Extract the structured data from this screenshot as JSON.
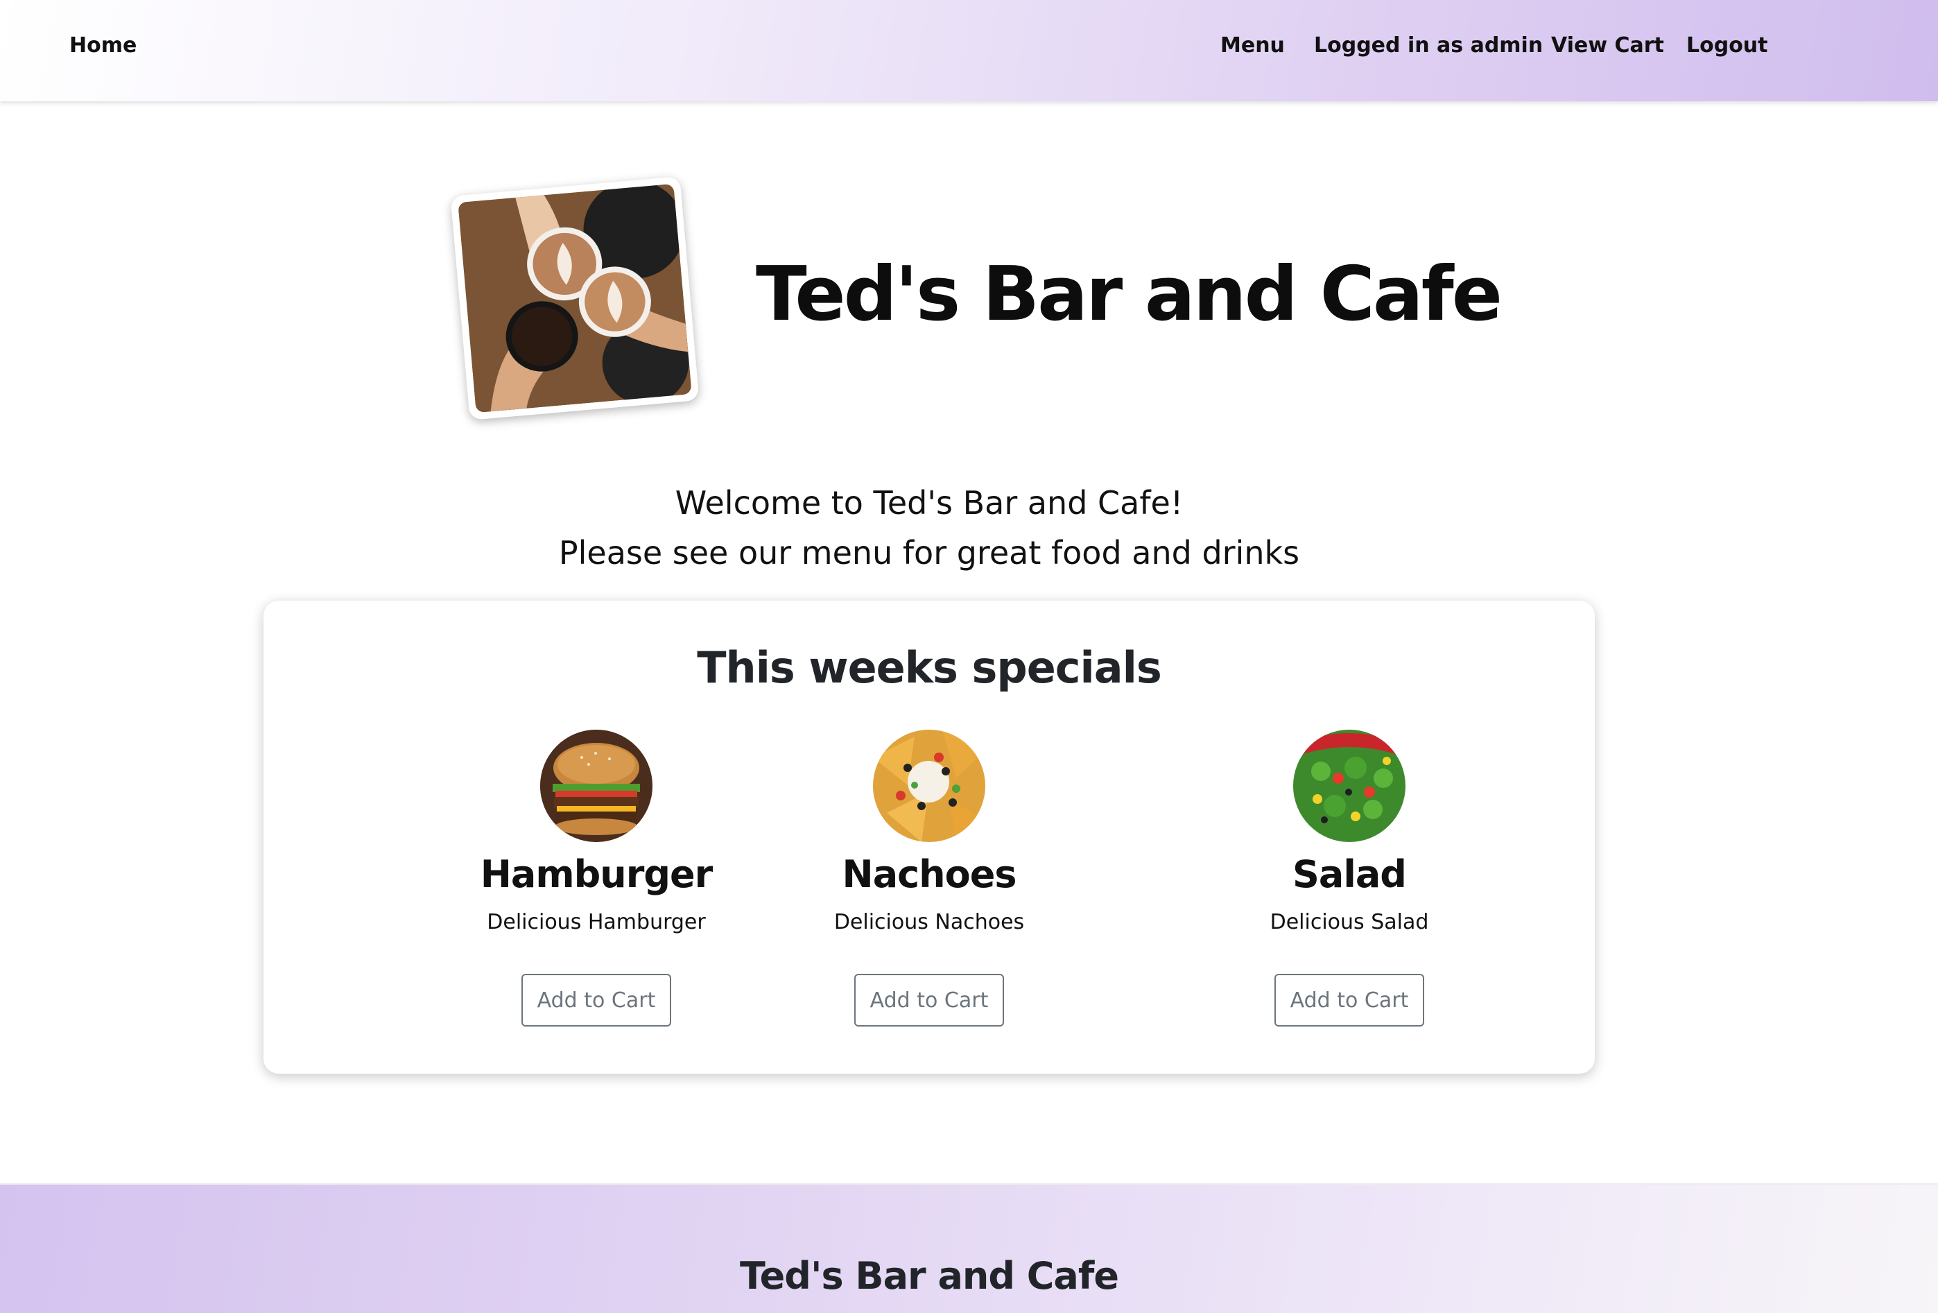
{
  "nav": {
    "home": "Home",
    "menu": "Menu",
    "user": "Logged in as admin",
    "cart": "View Cart",
    "logout": "Logout"
  },
  "hero": {
    "title": "Ted's Bar and Cafe",
    "welcome_line1": "Welcome to Ted's Bar and Cafe!",
    "welcome_line2": "Please see our menu for great food and drinks"
  },
  "specials": {
    "title": "This weeks specials",
    "items": [
      {
        "name": "Hamburger",
        "description": "Delicious Hamburger",
        "button": "Add to Cart"
      },
      {
        "name": "Nachoes",
        "description": "Delicious Nachoes",
        "button": "Add to Cart"
      },
      {
        "name": "Salad",
        "description": "Delicious Salad",
        "button": "Add to Cart"
      }
    ]
  },
  "footer": {
    "title": "Ted's Bar and Cafe"
  },
  "colors": {
    "nav_gradient_end": "#d0bdee",
    "button_outline": "#6c757d"
  }
}
